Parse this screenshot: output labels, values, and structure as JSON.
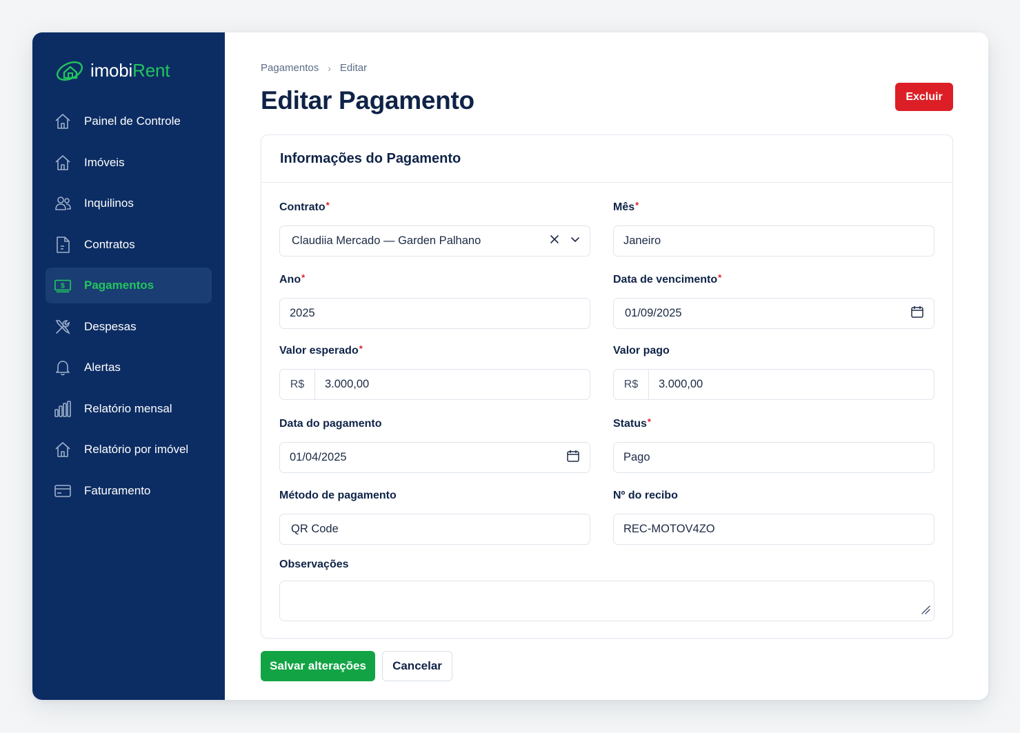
{
  "brand": {
    "name_part1": "imobi",
    "name_part2": "Rent",
    "accent": "#22c55e",
    "sidebar_bg": "#0c2d63"
  },
  "sidebar": {
    "items": [
      {
        "label": "Painel de Controle",
        "icon": "home-icon",
        "active": false
      },
      {
        "label": "Imóveis",
        "icon": "home-icon",
        "active": false
      },
      {
        "label": "Inquilinos",
        "icon": "users-icon",
        "active": false
      },
      {
        "label": "Contratos",
        "icon": "document-icon",
        "active": false
      },
      {
        "label": "Pagamentos",
        "icon": "money-icon",
        "active": true
      },
      {
        "label": "Despesas",
        "icon": "tools-icon",
        "active": false
      },
      {
        "label": "Alertas",
        "icon": "bell-icon",
        "active": false
      },
      {
        "label": "Relatório mensal",
        "icon": "bar-chart-icon",
        "active": false
      },
      {
        "label": "Relatório por imóvel",
        "icon": "home-icon",
        "active": false
      },
      {
        "label": "Faturamento",
        "icon": "credit-card-icon",
        "active": false
      }
    ]
  },
  "breadcrumb": {
    "parent": "Pagamentos",
    "separator": "›",
    "current": "Editar"
  },
  "page": {
    "title": "Editar Pagamento",
    "delete_label": "Excluir",
    "delete_color": "#dc1f26"
  },
  "card": {
    "title": "Informações do Pagamento"
  },
  "form": {
    "contrato": {
      "label": "Contrato",
      "required": "*",
      "value": "Claudiia Mercado — Garden Palhano"
    },
    "mes": {
      "label": "Mês",
      "required": "*",
      "value": "Janeiro"
    },
    "ano": {
      "label": "Ano",
      "required": "*",
      "value": "2025"
    },
    "vencimento": {
      "label": "Data de vencimento",
      "required": "*",
      "value": "01/09/2025"
    },
    "valor_esperado": {
      "label": "Valor esperado",
      "required": "*",
      "prefix": "R$",
      "value": "3.000,00"
    },
    "valor_pago": {
      "label": "Valor pago",
      "prefix": "R$",
      "value": "3.000,00"
    },
    "data_pagamento": {
      "label": "Data do pagamento",
      "value": "01/04/2025"
    },
    "status": {
      "label": "Status",
      "required": "*",
      "value": "Pago"
    },
    "metodo": {
      "label": "Método de pagamento",
      "value": "QR Code"
    },
    "recibo": {
      "label": "Nº do recibo",
      "value": "REC-MOTOV4ZO"
    },
    "observacoes": {
      "label": "Observações",
      "value": ""
    }
  },
  "actions": {
    "save_label": "Salvar alterações",
    "cancel_label": "Cancelar",
    "save_color": "#12a444"
  }
}
